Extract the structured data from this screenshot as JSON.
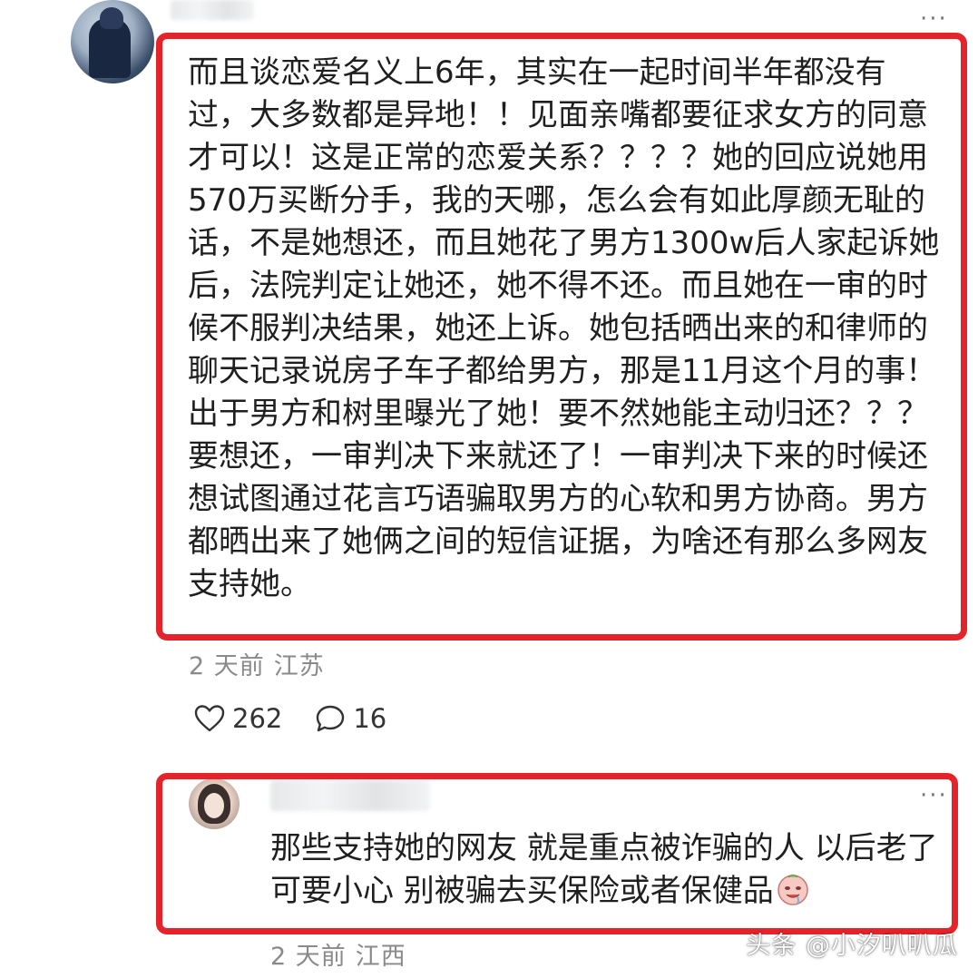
{
  "comment1": {
    "lines": [
      "而且谈恋爱名义上6年，其实在一起时间半年都没有",
      "过，大多数都是异地！！见面亲嘴都要征求女方的同意",
      "才可以！这是正常的恋爱关系？？？？她的回应说她用",
      "570万买断分手，我的天哪，怎么会有如此厚颜无耻的",
      "话，不是她想还，而且她花了男方1300w后人家起诉她",
      "后，法院判定让她还，她不得不还。而且她在一审的时",
      "候不服判决结果，她还上诉。她包括晒出来的和律师的",
      "聊天记录说房子车子都给男方，那是11月这个月的事！",
      "出于男方和树里曝光了她！要不然她能主动归还？？？",
      "要想还，一审判决下来就还了！一审判决下来的时候还",
      "想试图通过花言巧语骗取男方的心软和男方协商。男方",
      "都晒出来了她俩之间的短信证据，为啥还有那么多网友",
      "支持她。"
    ],
    "time": "2 天前",
    "location": "江苏",
    "likes": "262",
    "replies": "16",
    "more_icon": "more-horizontal-icon"
  },
  "comment2": {
    "lines": [
      "那些支持她的网友 就是重点被诈骗的人 以后老了",
      "可要小心 别被骗去买保险或者保健品"
    ],
    "time": "2 天前",
    "location": "江西",
    "emoji": "drooling-face-emoji",
    "more_icon": "more-horizontal-icon"
  },
  "watermark": "头条 @小汐叭叭瓜",
  "colors": {
    "highlight_border": "#e5232b",
    "meta_text": "#8a8a8a",
    "body_text": "#1f1f1f"
  },
  "icons": {
    "like": "heart-outline-icon",
    "reply": "speech-bubble-icon"
  }
}
